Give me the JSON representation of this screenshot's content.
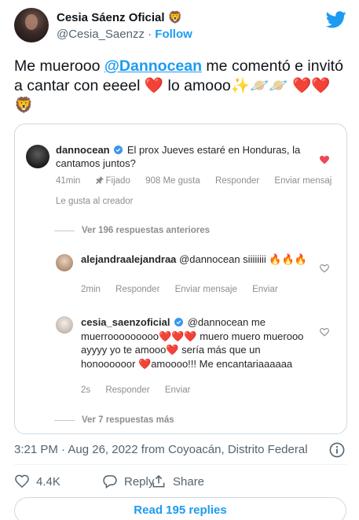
{
  "author": {
    "name": "Cesia Sáenz Oficial 🦁",
    "handle": "@Cesia_Saenzz",
    "separator": "·",
    "follow_label": "Follow"
  },
  "tweet": {
    "text_1": "Me muerooo ",
    "mention": "@Dannocean",
    "text_2": "  me comentó e invitó a cantar con eeeel ❤️ lo amooo✨🪐🪐 ❤️❤️🦁"
  },
  "instagram": {
    "main_comment": {
      "user": "dannocean",
      "text": "El prox Jueves estaré en Honduras, la cantamos juntos?",
      "meta": [
        "41min",
        "Fijado",
        "908 Me gusta",
        "Responder",
        "Enviar mensaj"
      ],
      "liked_by_creator": "Le gusta al creador"
    },
    "view_previous": "Ver 196 respuestas anteriores",
    "reply_1": {
      "user": "alejandraalejandraa",
      "text": "@dannocean siiiiiiii 🔥🔥🔥",
      "meta": [
        "2min",
        "Responder",
        "Enviar mensaje",
        "Enviar"
      ]
    },
    "reply_2": {
      "user": "cesia_saenzoficial",
      "text": "@dannocean me muerrooooooooo❤️❤️❤️ muero muero muerooo ayyyy yo te amooo❤️ sería más que un honoooooor ❤️amoooo!!! Me encantariaaaaaa",
      "meta": [
        "2s",
        "Responder",
        "Enviar"
      ]
    },
    "view_more": "Ver 7 respuestas más"
  },
  "timestamp": "3:21 PM · Aug 26, 2022 from Coyoacán, Distrito Federal",
  "actions": {
    "likes": "4.4K",
    "reply_label": "Reply",
    "share_label": "Share"
  },
  "read_replies": "Read 195 replies",
  "colors": {
    "twitter_blue": "#1d9bf0",
    "ig_red": "#ed4956",
    "verified_blue": "#3897f0"
  }
}
